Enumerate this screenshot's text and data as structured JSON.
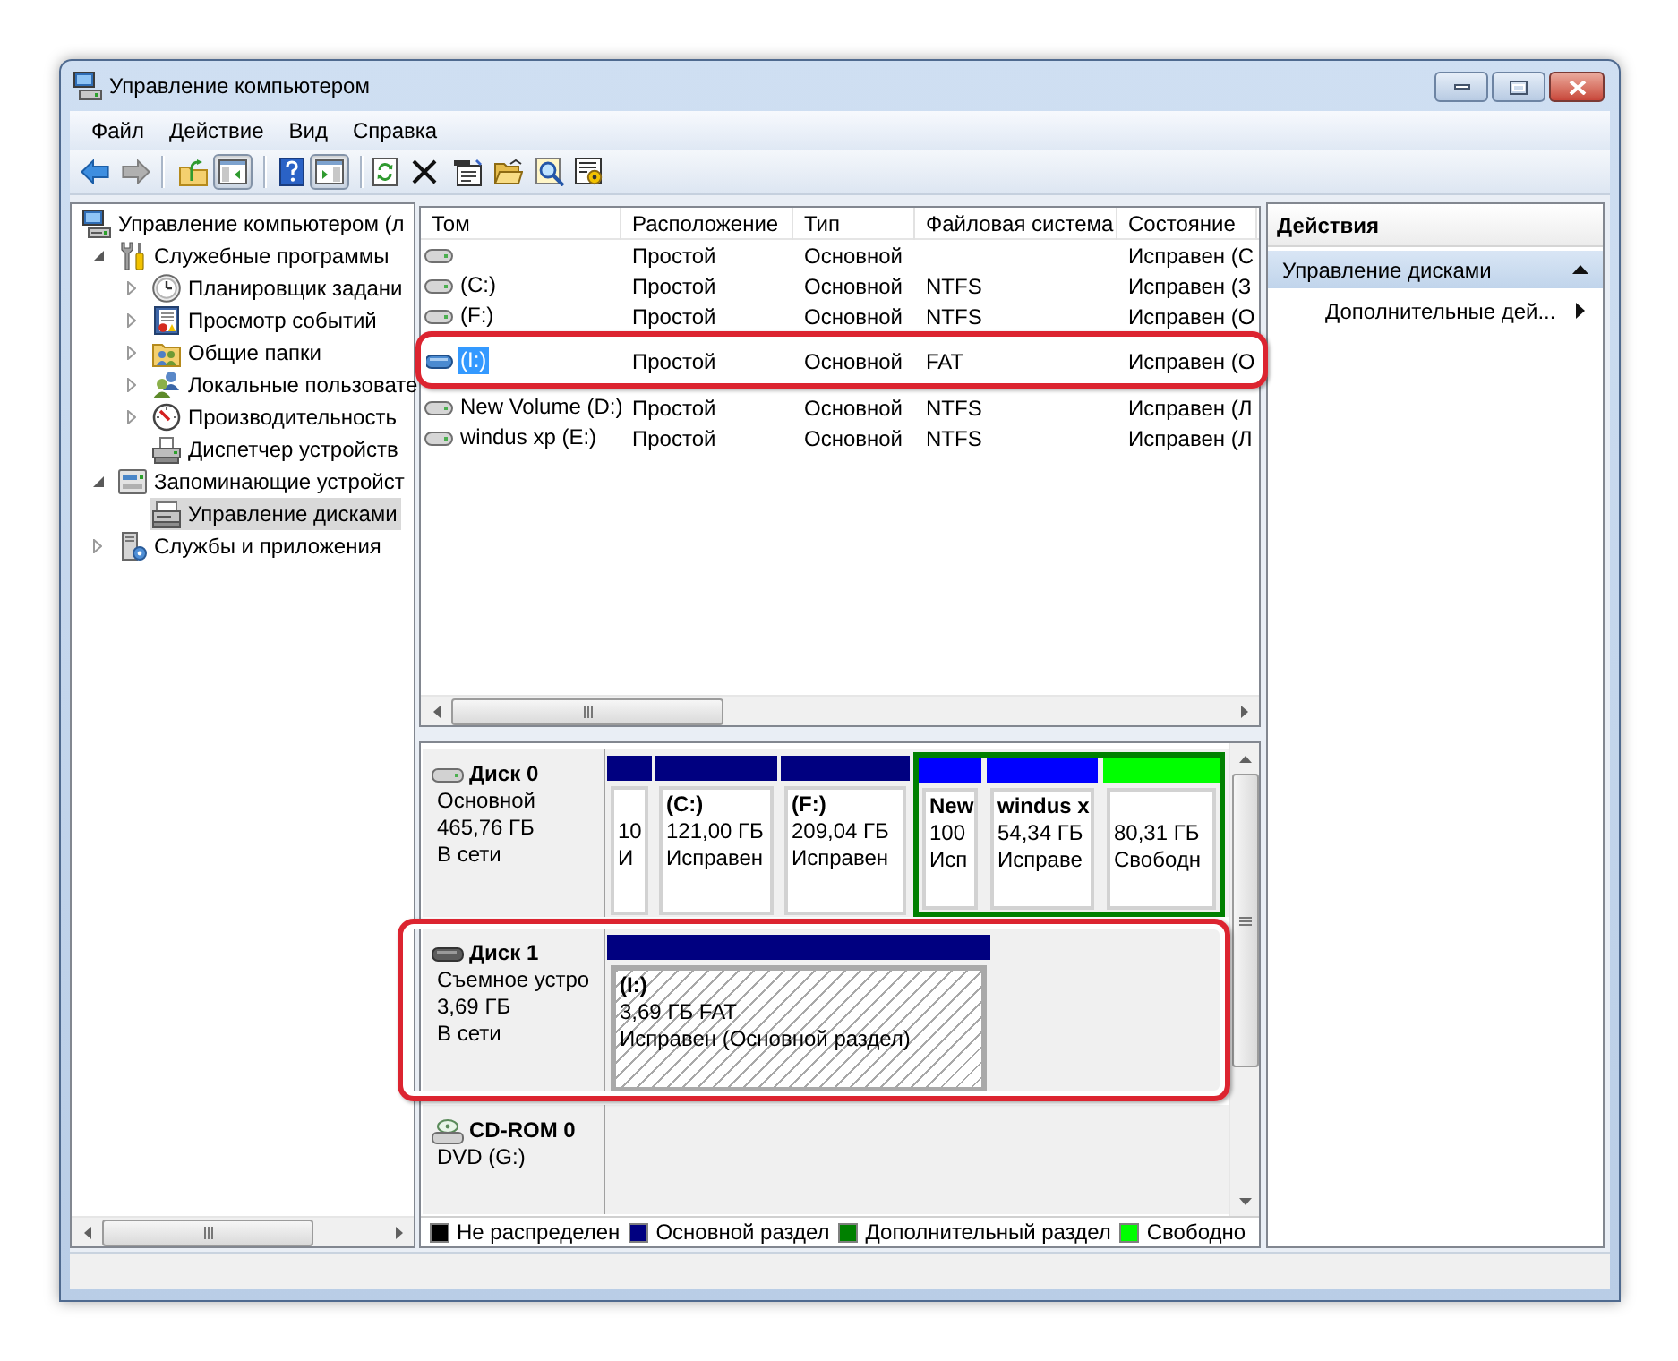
{
  "window": {
    "title": "Управление компьютером"
  },
  "menu": [
    {
      "label": "Файл"
    },
    {
      "label": "Действие"
    },
    {
      "label": "Вид"
    },
    {
      "label": "Справка"
    }
  ],
  "toolbar": {
    "back": {
      "disabled": false
    },
    "forward": {
      "disabled": true
    },
    "console_tree": {
      "pressed": true
    },
    "action_pane": {
      "pressed": true
    }
  },
  "tree": [
    {
      "label": "Управление компьютером (л",
      "kind": "computer",
      "selected": false,
      "children": [
        {
          "label": "Служебные программы",
          "kind": "tools",
          "expanded": true,
          "selected": false,
          "children": [
            {
              "label": "Планировщик задани",
              "kind": "scheduler",
              "expanded": false,
              "selected": false
            },
            {
              "label": "Просмотр событий",
              "kind": "events",
              "expanded": false,
              "selected": false
            },
            {
              "label": "Общие папки",
              "kind": "shared_folders",
              "expanded": false,
              "selected": false
            },
            {
              "label": "Локальные пользовате",
              "kind": "users",
              "expanded": false,
              "selected": false
            },
            {
              "label": "Производительность",
              "kind": "performance",
              "expanded": false,
              "selected": false
            },
            {
              "label": "Диспетчер устройств",
              "kind": "devices",
              "selected": false
            }
          ]
        },
        {
          "label": "Запоминающие устройст",
          "kind": "storage",
          "expanded": true,
          "selected": false,
          "children": [
            {
              "label": "Управление дисками",
              "kind": "disks",
              "selected": true
            }
          ]
        },
        {
          "label": "Службы и приложения",
          "kind": "services",
          "expanded": false,
          "selected": false
        }
      ]
    }
  ],
  "volumes": {
    "columns": [
      "Том",
      "Расположение",
      "Тип",
      "Файловая система",
      "Состояние"
    ],
    "rows": [
      {
        "kind": "fixed",
        "selected": false,
        "highlighted": false,
        "layout": "Простой",
        "type": "Основной",
        "status": "Исправен (С"
      },
      {
        "name": "(C:)",
        "kind": "fixed",
        "selected": false,
        "highlighted": false,
        "layout": "Простой",
        "type": "Основной",
        "file_system": "NTFS",
        "status": "Исправен (З"
      },
      {
        "name": "(F:)",
        "kind": "fixed",
        "selected": false,
        "highlighted": false,
        "layout": "Простой",
        "type": "Основной",
        "file_system": "NTFS",
        "status": "Исправен (О"
      },
      {
        "name": "(I:)",
        "kind": "removable",
        "selected": true,
        "highlighted": true,
        "layout": "Простой",
        "type": "Основной",
        "file_system": "FAT",
        "status": "Исправен (О"
      },
      {
        "name": "New Volume (D:)",
        "kind": "fixed",
        "selected": false,
        "highlighted": false,
        "layout": "Простой",
        "type": "Основной",
        "file_system": "NTFS",
        "status": "Исправен (Л"
      },
      {
        "name": "windus xp (E:)",
        "kind": "fixed",
        "selected": false,
        "highlighted": false,
        "layout": "Простой",
        "type": "Основной",
        "file_system": "NTFS",
        "status": "Исправен (Л"
      }
    ]
  },
  "disk_map": {
    "disks": [
      {
        "name": "Диск 0",
        "kind": "hdd",
        "highlighted": false,
        "lines": [
          "Основной",
          "465,76 ГБ",
          "В сети"
        ],
        "partitions": [
          {
            "kind": "primary",
            "color": "#000080",
            "selected": false,
            "lines": [
              "10",
              "И"
            ]
          },
          {
            "kind": "primary",
            "color": "#000080",
            "selected": false,
            "title": "(C:)",
            "lines": [
              "121,00 ГБ",
              "Исправен"
            ]
          },
          {
            "kind": "primary",
            "color": "#000080",
            "selected": false,
            "title": "(F:)",
            "lines": [
              "209,04 ГБ",
              "Исправен"
            ]
          },
          {
            "kind": "extended",
            "color": "#008000",
            "children": [
              {
                "color": "#0000ff",
                "selected": false,
                "title": "New",
                "lines": [
                  "100",
                  "Исп"
                ]
              },
              {
                "color": "#0000ff",
                "selected": false,
                "title": "windus x",
                "lines": [
                  "54,34 ГБ",
                  "Исправе"
                ]
              },
              {
                "color": "#00ff00",
                "selected": false,
                "lines": [
                  "80,31 ГБ",
                  "Свободн"
                ]
              }
            ]
          }
        ]
      },
      {
        "name": "Диск 1",
        "kind": "removable",
        "highlighted": true,
        "lines": [
          "Съемное устро",
          "3,69 ГБ",
          "В сети"
        ],
        "partitions": [
          {
            "kind": "primary",
            "color": "#000080",
            "selected": true,
            "title": "(I:)",
            "lines": [
              "3,69 ГБ FAT",
              "Исправен (Основной раздел)"
            ]
          }
        ]
      },
      {
        "name": "CD-ROM 0",
        "kind": "cdrom",
        "highlighted": false,
        "lines": [
          "DVD (G:)"
        ]
      }
    ],
    "legend": [
      {
        "label": "Не распределен",
        "color": "#000000"
      },
      {
        "label": "Основной раздел",
        "color": "#000080"
      },
      {
        "label": "Дополнительный раздел",
        "color": "#008000"
      },
      {
        "label": "Свободно",
        "color": "#00ff00"
      }
    ]
  },
  "actions": {
    "title": "Действия",
    "sections": [
      {
        "label": "Управление дисками",
        "expanded": true,
        "items": [
          {
            "label": "Дополнительные дей...",
            "submenu": true
          }
        ]
      }
    ]
  }
}
